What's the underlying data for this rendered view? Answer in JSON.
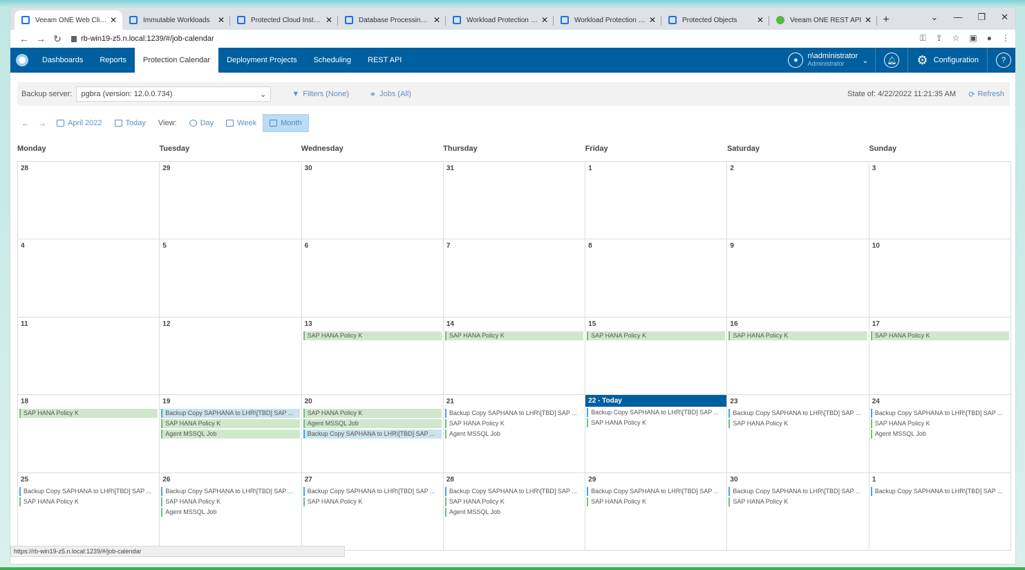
{
  "browser": {
    "tabs": [
      {
        "label": "Veeam ONE Web Client",
        "active": true
      },
      {
        "label": "Immutable Workloads"
      },
      {
        "label": "Protected Cloud Instances"
      },
      {
        "label": "Database Processing Verif"
      },
      {
        "label": "Workload Protection Histo"
      },
      {
        "label": "Workload Protection Histo"
      },
      {
        "label": "Protected Objects"
      },
      {
        "label": "Veeam ONE REST API"
      }
    ],
    "url": "rb-win19-z5.n.local:1239/#/job-calendar"
  },
  "nav": {
    "items": [
      "Dashboards",
      "Reports",
      "Protection Calendar",
      "Deployment Projects",
      "Scheduling",
      "REST API"
    ],
    "user_name": "n\\administrator",
    "user_role": "Administrator",
    "configuration": "Configuration"
  },
  "toolbar": {
    "backup_server_label": "Backup server:",
    "backup_server_value": "pgbra (version: 12.0.0.734)",
    "filters": "Filters (None)",
    "jobs": "Jobs (All)",
    "state": "State of: 4/22/2022 11:21:35 AM",
    "refresh": "Refresh"
  },
  "viewbar": {
    "month_label": "April 2022",
    "today": "Today",
    "view_label": "View:",
    "day": "Day",
    "week": "Week",
    "month": "Month",
    "active_view": "Month"
  },
  "calendar": {
    "weekdays": [
      "Monday",
      "Tuesday",
      "Wednesday",
      "Thursday",
      "Friday",
      "Saturday",
      "Sunday"
    ],
    "weeks": [
      [
        {
          "d": "28",
          "e": []
        },
        {
          "d": "29",
          "e": []
        },
        {
          "d": "30",
          "e": []
        },
        {
          "d": "31",
          "e": []
        },
        {
          "d": "1",
          "e": []
        },
        {
          "d": "2",
          "e": []
        },
        {
          "d": "3",
          "e": []
        }
      ],
      [
        {
          "d": "4",
          "e": []
        },
        {
          "d": "5",
          "e": []
        },
        {
          "d": "6",
          "e": []
        },
        {
          "d": "7",
          "e": []
        },
        {
          "d": "8",
          "e": []
        },
        {
          "d": "9",
          "e": []
        },
        {
          "d": "10",
          "e": []
        }
      ],
      [
        {
          "d": "11",
          "e": []
        },
        {
          "d": "12",
          "e": []
        },
        {
          "d": "13",
          "e": [
            {
              "t": "SAP HANA Policy K",
              "f": 1
            }
          ]
        },
        {
          "d": "14",
          "e": [
            {
              "t": "SAP HANA Policy K",
              "f": 1
            }
          ]
        },
        {
          "d": "15",
          "e": [
            {
              "t": "SAP HANA Policy K",
              "f": 1
            }
          ]
        },
        {
          "d": "16",
          "e": [
            {
              "t": "SAP HANA Policy K",
              "f": 1
            }
          ]
        },
        {
          "d": "17",
          "e": [
            {
              "t": "SAP HANA Policy K",
              "f": 1
            }
          ]
        }
      ],
      [
        {
          "d": "18",
          "e": [
            {
              "t": "SAP HANA Policy K",
              "f": 1
            }
          ]
        },
        {
          "d": "19",
          "e": [
            {
              "t": "Backup Copy SAPHANA to LHR\\[TBD] SAP ...",
              "f": 1,
              "b": 1
            },
            {
              "t": "SAP HANA Policy K",
              "f": 1
            },
            {
              "t": "Agent MSSQL Job",
              "f": 1
            }
          ]
        },
        {
          "d": "20",
          "e": [
            {
              "t": "SAP HANA Policy K",
              "f": 1
            },
            {
              "t": "Agent MSSQL Job",
              "f": 1
            },
            {
              "t": "Backup Copy SAPHANA to LHR\\[TBD] SAP ...",
              "f": 1,
              "b": 1
            }
          ]
        },
        {
          "d": "21",
          "e": [
            {
              "t": "Backup Copy SAPHANA to LHR\\[TBD] SAP ...",
              "b": 1
            },
            {
              "t": "SAP HANA Policy K"
            },
            {
              "t": "Agent MSSQL Job"
            }
          ]
        },
        {
          "d": "22 - Today",
          "today": 1,
          "e": [
            {
              "t": "Backup Copy SAPHANA to LHR\\[TBD] SAP ...",
              "b": 1
            },
            {
              "t": "SAP HANA Policy K"
            }
          ]
        },
        {
          "d": "23",
          "e": [
            {
              "t": "Backup Copy SAPHANA to LHR\\[TBD] SAP ...",
              "b": 1
            },
            {
              "t": "SAP HANA Policy K"
            }
          ]
        },
        {
          "d": "24",
          "e": [
            {
              "t": "Backup Copy SAPHANA to LHR\\[TBD] SAP ...",
              "b": 1
            },
            {
              "t": "SAP HANA Policy K"
            },
            {
              "t": "Agent MSSQL Job"
            }
          ]
        }
      ],
      [
        {
          "d": "25",
          "e": [
            {
              "t": "Backup Copy SAPHANA to LHR\\[TBD] SAP ...",
              "b": 1
            },
            {
              "t": "SAP HANA Policy K"
            }
          ]
        },
        {
          "d": "26",
          "e": [
            {
              "t": "Backup Copy SAPHANA to LHR\\[TBD] SAP ...",
              "b": 1
            },
            {
              "t": "SAP HANA Policy K"
            },
            {
              "t": "Agent MSSQL Job"
            }
          ]
        },
        {
          "d": "27",
          "e": [
            {
              "t": "Backup Copy SAPHANA to LHR\\[TBD] SAP ...",
              "b": 1
            },
            {
              "t": "SAP HANA Policy K"
            }
          ]
        },
        {
          "d": "28",
          "e": [
            {
              "t": "Backup Copy SAPHANA to LHR\\[TBD] SAP ...",
              "b": 1
            },
            {
              "t": "SAP HANA Policy K"
            },
            {
              "t": "Agent MSSQL Job"
            }
          ]
        },
        {
          "d": "29",
          "e": [
            {
              "t": "Backup Copy SAPHANA to LHR\\[TBD] SAP ...",
              "b": 1
            },
            {
              "t": "SAP HANA Policy K"
            }
          ]
        },
        {
          "d": "30",
          "e": [
            {
              "t": "Backup Copy SAPHANA to LHR\\[TBD] SAP ...",
              "b": 1
            },
            {
              "t": "SAP HANA Policy K"
            }
          ]
        },
        {
          "d": "1",
          "e": [
            {
              "t": "Backup Copy SAPHANA to LHR\\[TBD] SAP ...",
              "b": 1
            }
          ]
        }
      ]
    ]
  },
  "status_url": "https://rb-win19-z5.n.local:1239/#/job-calendar",
  "colors": {
    "nav": "#005f9e",
    "event_green": "#6ec07a",
    "event_blue": "#4aa3df"
  }
}
